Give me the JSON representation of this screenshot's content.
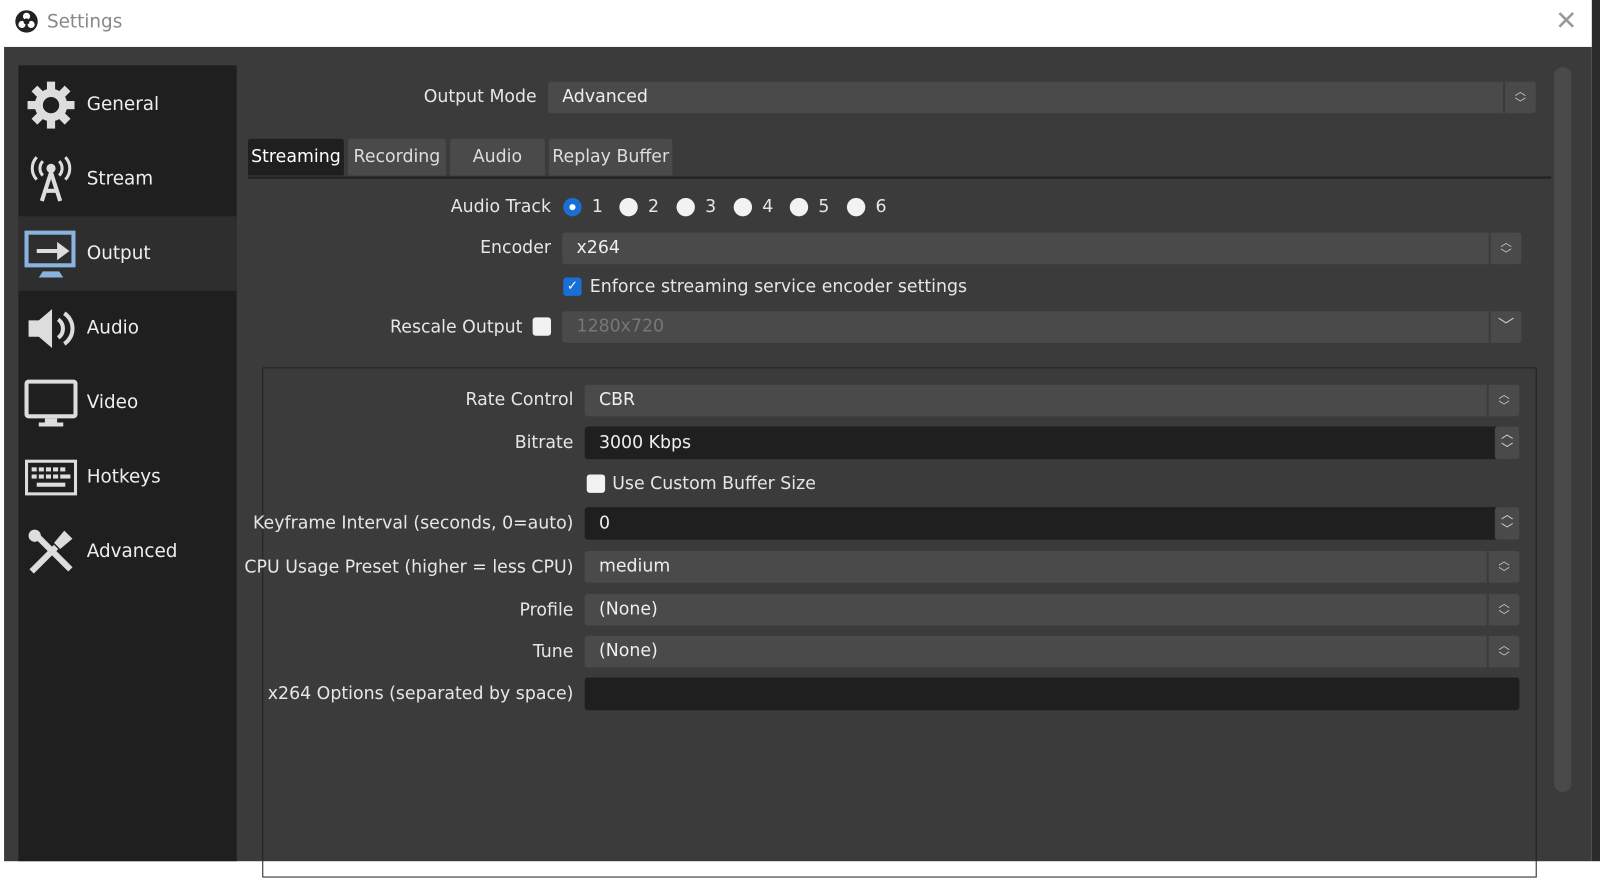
{
  "window": {
    "title": "Settings",
    "close": "✕"
  },
  "sidebar": {
    "items": [
      {
        "label": "General",
        "icon": "gear-icon"
      },
      {
        "label": "Stream",
        "icon": "antenna-icon"
      },
      {
        "label": "Output",
        "icon": "monitor-arrow-icon",
        "selected": true
      },
      {
        "label": "Audio",
        "icon": "speaker-icon"
      },
      {
        "label": "Video",
        "icon": "monitor-icon"
      },
      {
        "label": "Hotkeys",
        "icon": "keyboard-icon"
      },
      {
        "label": "Advanced",
        "icon": "tools-icon"
      }
    ]
  },
  "output_mode": {
    "label": "Output Mode",
    "value": "Advanced"
  },
  "tabs": [
    {
      "label": "Streaming",
      "selected": true
    },
    {
      "label": "Recording"
    },
    {
      "label": "Audio"
    },
    {
      "label": "Replay Buffer"
    }
  ],
  "streaming": {
    "audio_track": {
      "label": "Audio Track",
      "options": [
        "1",
        "2",
        "3",
        "4",
        "5",
        "6"
      ],
      "selected": "1"
    },
    "encoder": {
      "label": "Encoder",
      "value": "x264"
    },
    "enforce": {
      "label": "Enforce streaming service encoder settings",
      "checked": true
    },
    "rescale": {
      "label": "Rescale Output",
      "checked": false,
      "value": "1280x720"
    },
    "rate_control": {
      "label": "Rate Control",
      "value": "CBR"
    },
    "bitrate": {
      "label": "Bitrate",
      "value": "3000 Kbps"
    },
    "custom_buffer": {
      "label": "Use Custom Buffer Size",
      "checked": false
    },
    "keyframe": {
      "label": "Keyframe Interval (seconds, 0=auto)",
      "value": "0"
    },
    "cpu_preset": {
      "label": "CPU Usage Preset (higher = less CPU)",
      "value": "medium"
    },
    "profile": {
      "label": "Profile",
      "value": "(None)"
    },
    "tune": {
      "label": "Tune",
      "value": "(None)"
    },
    "x264_options": {
      "label": "x264 Options (separated by space)",
      "value": ""
    }
  }
}
